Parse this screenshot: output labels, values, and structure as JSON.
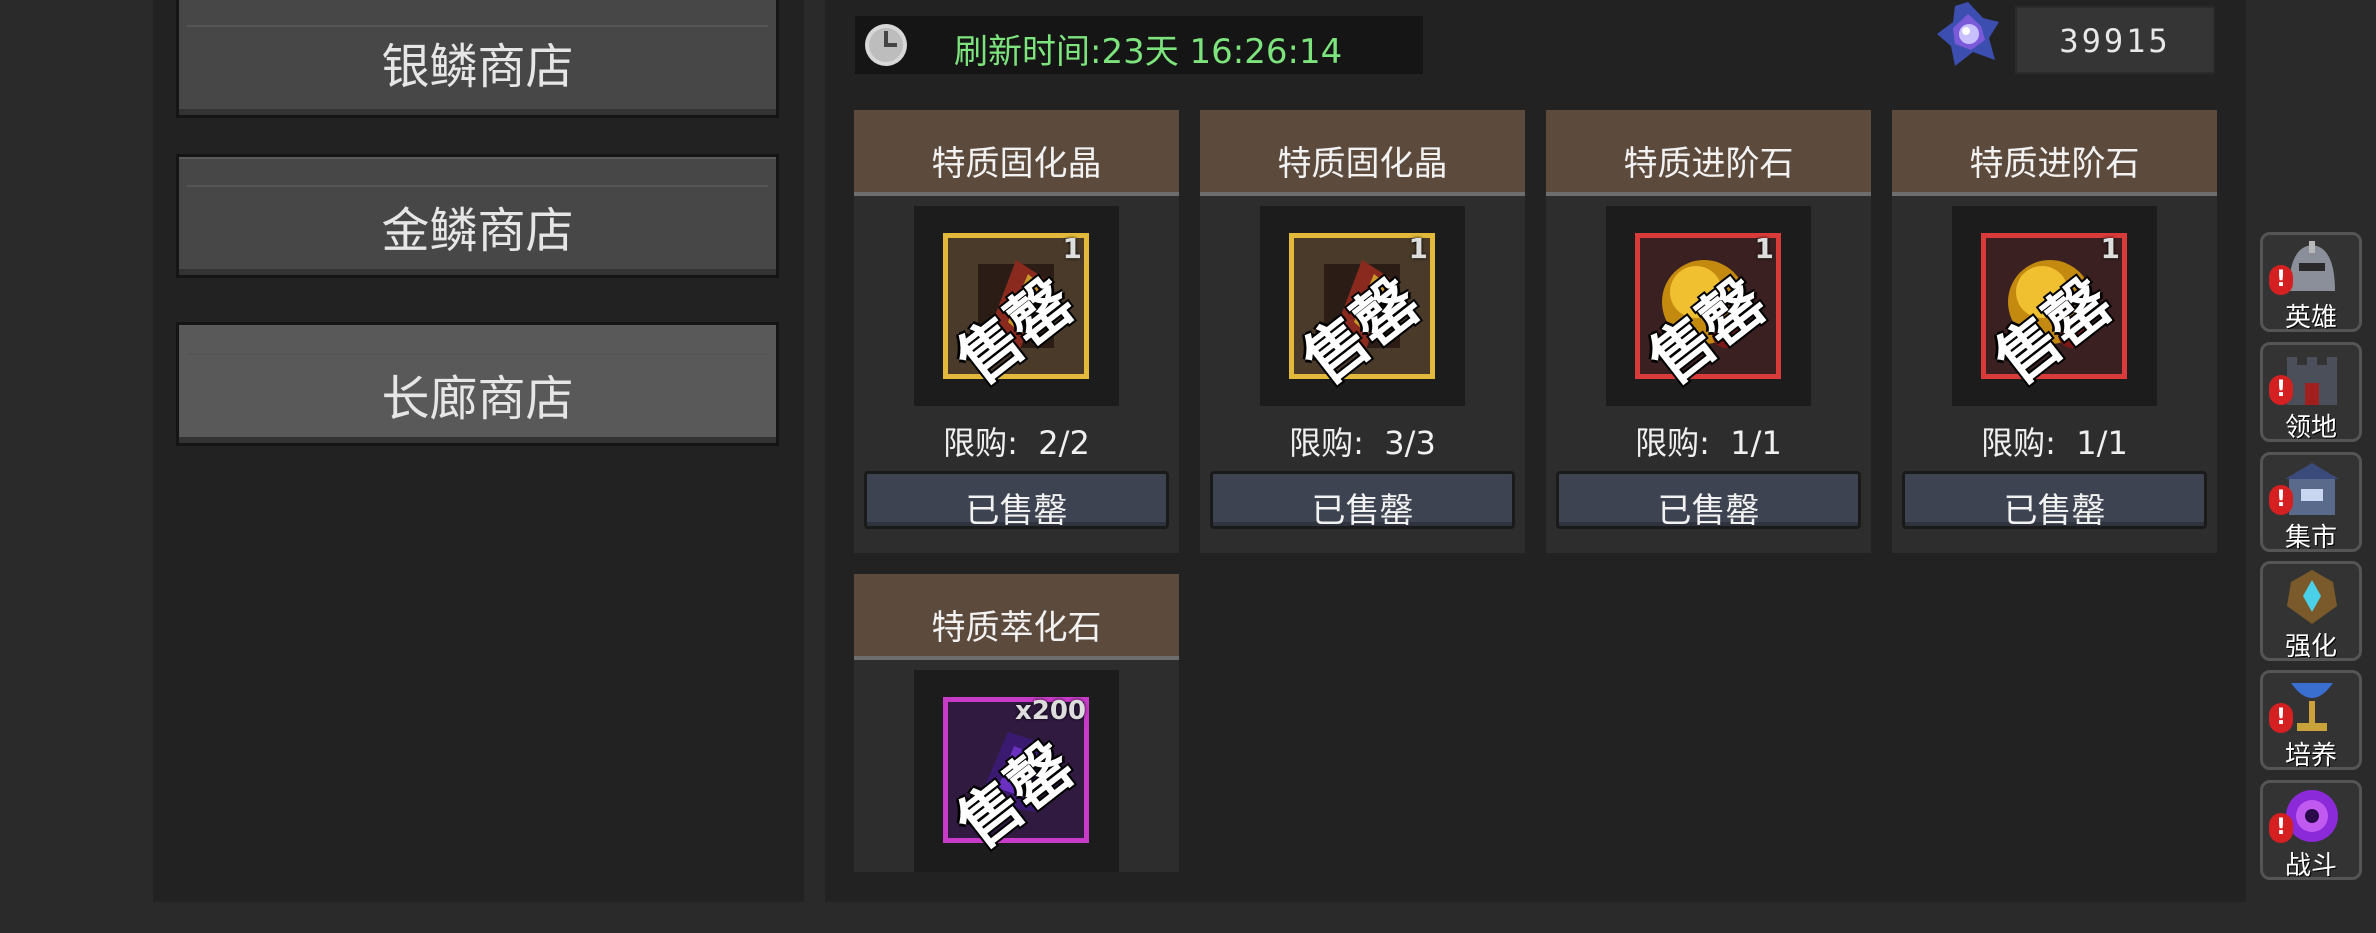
{
  "shops": [
    {
      "label": "银鳞商店",
      "active": false
    },
    {
      "label": "金鳞商店",
      "active": false
    },
    {
      "label": "长廊商店",
      "active": true
    }
  ],
  "timer": {
    "text": "刷新时间:23天 16:26:14",
    "icon": "clock-icon"
  },
  "currency": {
    "value": "39915",
    "icon": "crystal-gem-icon"
  },
  "items": [
    {
      "title": "特质固化晶",
      "qty": "1",
      "stamp": "售罄",
      "limit": "限购:  2/2",
      "button": "已售罄",
      "frame": "gold"
    },
    {
      "title": "特质固化晶",
      "qty": "1",
      "stamp": "售罄",
      "limit": "限购:  3/3",
      "button": "已售罄",
      "frame": "gold"
    },
    {
      "title": "特质进阶石",
      "qty": "1",
      "stamp": "售罄",
      "limit": "限购:  1/1",
      "button": "已售罄",
      "frame": "red"
    },
    {
      "title": "特质进阶石",
      "qty": "1",
      "stamp": "售罄",
      "limit": "限购:  1/1",
      "button": "已售罄",
      "frame": "red"
    },
    {
      "title": "特质萃化石",
      "qty": "x200",
      "stamp": "售罄",
      "frame": "purple"
    }
  ],
  "nav": [
    {
      "label": "英雄",
      "icon": "helmet-icon",
      "alert": "!"
    },
    {
      "label": "领地",
      "icon": "castle-icon",
      "alert": "!"
    },
    {
      "label": "集市",
      "icon": "market-icon",
      "alert": "!"
    },
    {
      "label": "强化",
      "icon": "enhance-emblem-icon",
      "alert": ""
    },
    {
      "label": "培养",
      "icon": "chalice-icon",
      "alert": "!"
    },
    {
      "label": "战斗",
      "icon": "vortex-portal-icon",
      "alert": "!"
    }
  ],
  "colors": {
    "timer_text": "#7de37d",
    "card_header": "#5c4a3d",
    "button_bg": "#3d4350",
    "alert": "#d42020"
  }
}
